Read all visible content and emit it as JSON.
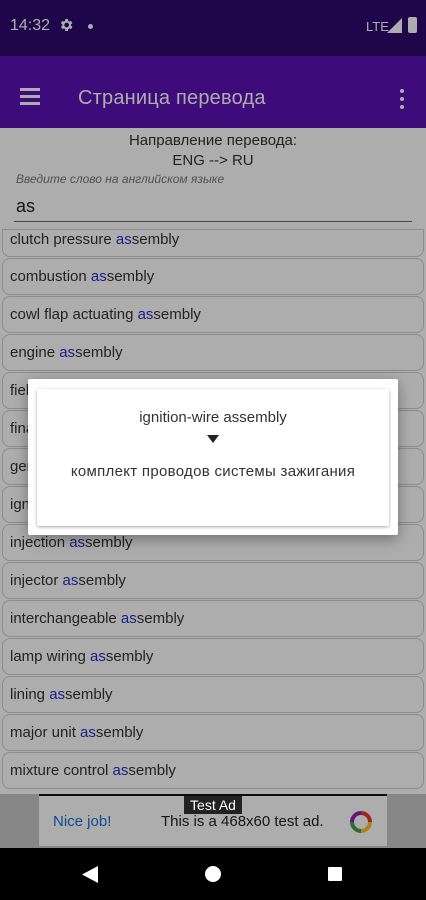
{
  "status_bar": {
    "time": "14:32",
    "network": "LTE"
  },
  "app_bar": {
    "title": "Страница перевода"
  },
  "direction": {
    "label": "Направление перевода:",
    "value": "ENG --> RU"
  },
  "search": {
    "hint": "Введите слово на английском языке",
    "value": "as"
  },
  "results": [
    {
      "prefix": "clutch pressure ",
      "match": "as",
      "suffix": "sembly"
    },
    {
      "prefix": "combustion ",
      "match": "as",
      "suffix": "sembly"
    },
    {
      "prefix": "cowl flap actuating ",
      "match": "as",
      "suffix": "sembly"
    },
    {
      "prefix": "engine ",
      "match": "as",
      "suffix": "sembly"
    },
    {
      "prefix": "fiel",
      "match": "",
      "suffix": ""
    },
    {
      "prefix": "fina",
      "match": "",
      "suffix": ""
    },
    {
      "prefix": "gen",
      "match": "",
      "suffix": ""
    },
    {
      "prefix": "ign",
      "match": "",
      "suffix": ""
    },
    {
      "prefix": "injection ",
      "match": "as",
      "suffix": "sembly"
    },
    {
      "prefix": "injector ",
      "match": "as",
      "suffix": "sembly"
    },
    {
      "prefix": "interchangeable ",
      "match": "as",
      "suffix": "sembly"
    },
    {
      "prefix": "lamp wiring ",
      "match": "as",
      "suffix": "sembly"
    },
    {
      "prefix": "lining ",
      "match": "as",
      "suffix": "sembly"
    },
    {
      "prefix": "major unit ",
      "match": "as",
      "suffix": "sembly"
    },
    {
      "prefix": "mixture control ",
      "match": "as",
      "suffix": "sembly"
    }
  ],
  "dialog": {
    "term": "ignition-wire assembly",
    "arrow_icon": "triangle-down-icon",
    "translation": "комплект проводов системы зажигания"
  },
  "ad": {
    "label": "Test Ad",
    "nice": "Nice job!",
    "text": "This is a 468x60 test ad."
  },
  "colors": {
    "status_bar": "#2f0a6e",
    "app_bar": "#5a12b4",
    "highlight": "#2b2bc7",
    "ad_link": "#1a6fd8"
  }
}
